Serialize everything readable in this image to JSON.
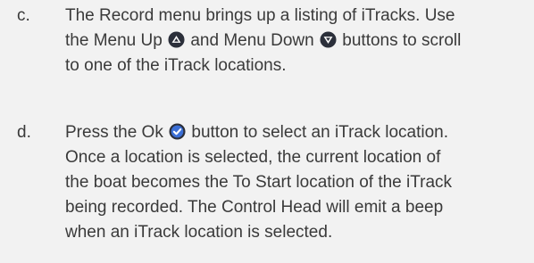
{
  "items": [
    {
      "marker": "c.",
      "lines": [
        {
          "text": "The Record menu brings up a listing of iTracks. Use"
        },
        {
          "before": "the Menu Up ",
          "icon": "menu-up-icon",
          "after": " and Menu Down ",
          "icon2": "menu-down-icon",
          "after2": " buttons to scroll"
        },
        {
          "text": "to one of the iTrack locations."
        }
      ]
    },
    {
      "marker": "d.",
      "lines": [
        {
          "before": "Press the Ok ",
          "icon": "ok-icon",
          "after": " button to select an iTrack location."
        },
        {
          "text": "Once a location is selected, the current location of"
        },
        {
          "text": "the boat becomes the To Start location of the iTrack"
        },
        {
          "text": "being recorded. The Control Head will emit a beep"
        },
        {
          "text": "when an iTrack location is selected."
        }
      ]
    }
  ],
  "colors": {
    "background": "#f2f2f2",
    "text": "#3a3a3a",
    "icon_dark": "#2b2f3a",
    "ok_blue": "#3b6fd6"
  }
}
